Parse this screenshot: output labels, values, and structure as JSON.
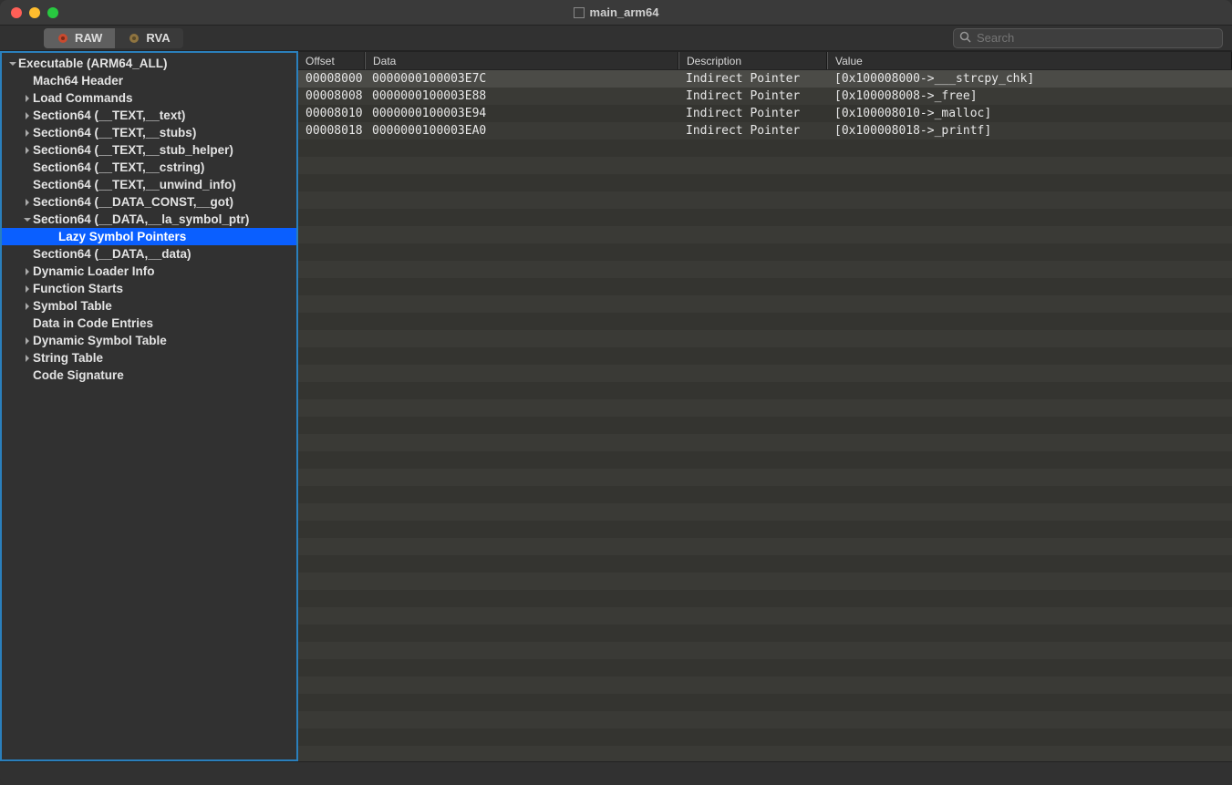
{
  "window": {
    "title": "main_arm64"
  },
  "toolbar": {
    "segments": [
      {
        "label": "RAW",
        "active": true
      },
      {
        "label": "RVA",
        "active": false
      }
    ]
  },
  "search": {
    "placeholder": "Search"
  },
  "tree": [
    {
      "depth": 0,
      "chev": "down",
      "label": "Executable  (ARM64_ALL)"
    },
    {
      "depth": 1,
      "chev": "none",
      "label": "Mach64 Header"
    },
    {
      "depth": 1,
      "chev": "right",
      "label": "Load Commands"
    },
    {
      "depth": 1,
      "chev": "right",
      "label": "Section64 (__TEXT,__text)"
    },
    {
      "depth": 1,
      "chev": "right",
      "label": "Section64 (__TEXT,__stubs)"
    },
    {
      "depth": 1,
      "chev": "right",
      "label": "Section64 (__TEXT,__stub_helper)"
    },
    {
      "depth": 1,
      "chev": "none",
      "label": "Section64 (__TEXT,__cstring)"
    },
    {
      "depth": 1,
      "chev": "none",
      "label": "Section64 (__TEXT,__unwind_info)"
    },
    {
      "depth": 1,
      "chev": "right",
      "label": "Section64 (__DATA_CONST,__got)"
    },
    {
      "depth": 1,
      "chev": "down",
      "label": "Section64 (__DATA,__la_symbol_ptr)"
    },
    {
      "depth": 2,
      "chev": "none",
      "label": "Lazy Symbol Pointers",
      "selected": true
    },
    {
      "depth": 1,
      "chev": "none",
      "label": "Section64 (__DATA,__data)"
    },
    {
      "depth": 1,
      "chev": "right",
      "label": "Dynamic Loader Info"
    },
    {
      "depth": 1,
      "chev": "right",
      "label": "Function Starts"
    },
    {
      "depth": 1,
      "chev": "right",
      "label": "Symbol Table"
    },
    {
      "depth": 1,
      "chev": "none",
      "label": "Data in Code Entries"
    },
    {
      "depth": 1,
      "chev": "right",
      "label": "Dynamic Symbol Table"
    },
    {
      "depth": 1,
      "chev": "right",
      "label": "String Table"
    },
    {
      "depth": 1,
      "chev": "none",
      "label": "Code Signature"
    }
  ],
  "columns": {
    "offset": "Offset",
    "data": "Data",
    "description": "Description",
    "value": "Value"
  },
  "rows": [
    {
      "offset": "00008000",
      "data": "0000000100003E7C",
      "description": "Indirect Pointer",
      "value": "[0x100008000->___strcpy_chk]",
      "selected": true
    },
    {
      "offset": "00008008",
      "data": "0000000100003E88",
      "description": "Indirect Pointer",
      "value": "[0x100008008->_free]"
    },
    {
      "offset": "00008010",
      "data": "0000000100003E94",
      "description": "Indirect Pointer",
      "value": "[0x100008010->_malloc]"
    },
    {
      "offset": "00008018",
      "data": "0000000100003EA0",
      "description": "Indirect Pointer",
      "value": "[0x100008018->_printf]"
    }
  ]
}
